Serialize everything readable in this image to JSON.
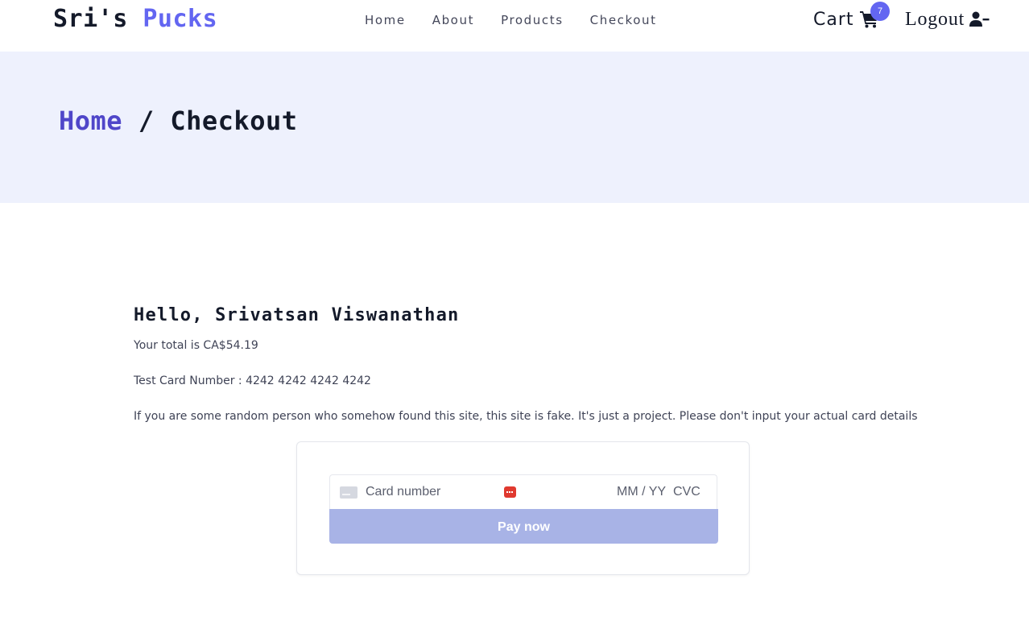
{
  "brand": {
    "part1": "Sri's",
    "part2": "Pucks"
  },
  "nav": {
    "items": [
      "Home",
      "About",
      "Products",
      "Checkout"
    ]
  },
  "cart": {
    "label": "Cart",
    "count": "7",
    "icon": "cart-icon"
  },
  "logout": {
    "label": "Logout",
    "icon": "user-minus-icon"
  },
  "breadcrumb": {
    "home": "Home",
    "separator": " / ",
    "current": "Checkout"
  },
  "main": {
    "greeting": "Hello, Srivatsan Viswanathan",
    "total": "Your total is CA$54.19",
    "test_card": "Test Card Number : 4242 4242 4242 4242",
    "disclaimer": "If you are some random person who somehow found this site, this site is fake. It's just a project. Please don't input your actual card details"
  },
  "payment": {
    "card_placeholder": "Card number",
    "exp_placeholder": "MM / YY",
    "cvc_placeholder": "CVC",
    "pay_label": "Pay now"
  },
  "colors": {
    "accent": "#6366f1",
    "hero_bg": "#eef1fd",
    "pay_button": "#a8b3e6"
  }
}
